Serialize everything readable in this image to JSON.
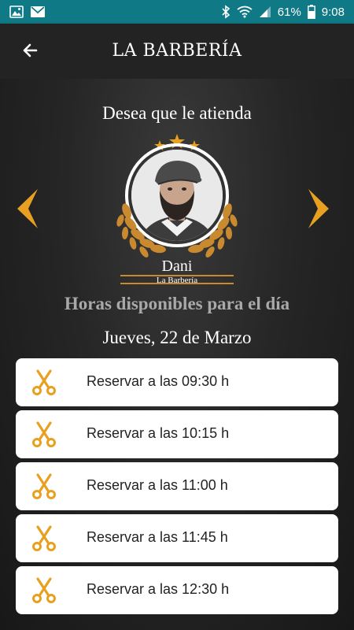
{
  "status_bar": {
    "battery": "61%",
    "time": "9:08"
  },
  "app_bar": {
    "title": "LA BARBERÍA"
  },
  "prompt": "Desea que le atienda",
  "barber": {
    "name": "Dani",
    "shop": "La Barbería"
  },
  "section_title": "Horas disponibles para el día",
  "date": "Jueves, 22 de Marzo",
  "slots": [
    {
      "label": "Reservar a las 09:30 h"
    },
    {
      "label": "Reservar a las 10:15 h"
    },
    {
      "label": "Reservar a las 11:00 h"
    },
    {
      "label": "Reservar a las 11:45 h"
    },
    {
      "label": "Reservar a las 12:30 h"
    }
  ],
  "colors": {
    "accent": "#e8a020",
    "status_bar": "#0f7a86",
    "app_bar": "#232323"
  },
  "icons": {
    "back": "arrow-left-icon",
    "prev": "chevron-left-icon",
    "next": "chevron-right-icon",
    "slot": "scissors-icon"
  }
}
